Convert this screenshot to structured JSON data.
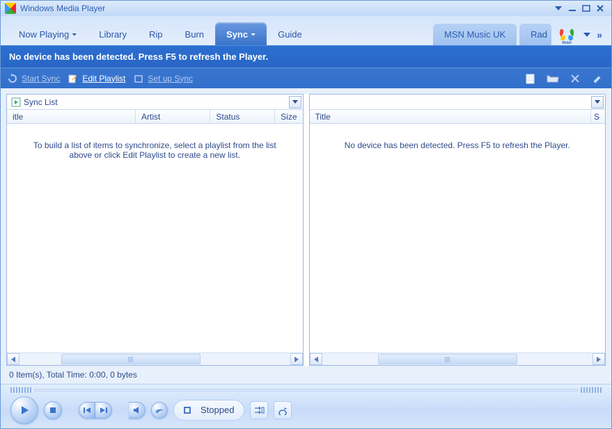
{
  "titlebar": {
    "title": "Windows Media Player"
  },
  "tabs": {
    "now_playing": "Now Playing",
    "library": "Library",
    "rip": "Rip",
    "burn": "Burn",
    "sync": "Sync",
    "guide": "Guide",
    "msn_music": "MSN Music UK",
    "radio": "Rad",
    "msn_label": "msn"
  },
  "message": "No device has been detected. Press F5 to refresh the Player.",
  "toolbar": {
    "start_sync": "Start Sync",
    "edit_playlist": "Edit Playlist",
    "setup_sync": "Set up Sync"
  },
  "left_pane": {
    "dropdown_label": "Sync List",
    "headers": {
      "title": "itle",
      "artist": "Artist",
      "status": "Status",
      "size": "Size"
    },
    "body_text": "To build a list of items to synchronize, select a playlist from the list above or click Edit Playlist to create a new list."
  },
  "right_pane": {
    "headers": {
      "title": "Title",
      "size": "S"
    },
    "body_text": "No device has been detected. Press F5 to refresh the Player."
  },
  "status_line": "0 Item(s), Total Time: 0:00, 0 bytes",
  "player": {
    "status": "Stopped"
  }
}
